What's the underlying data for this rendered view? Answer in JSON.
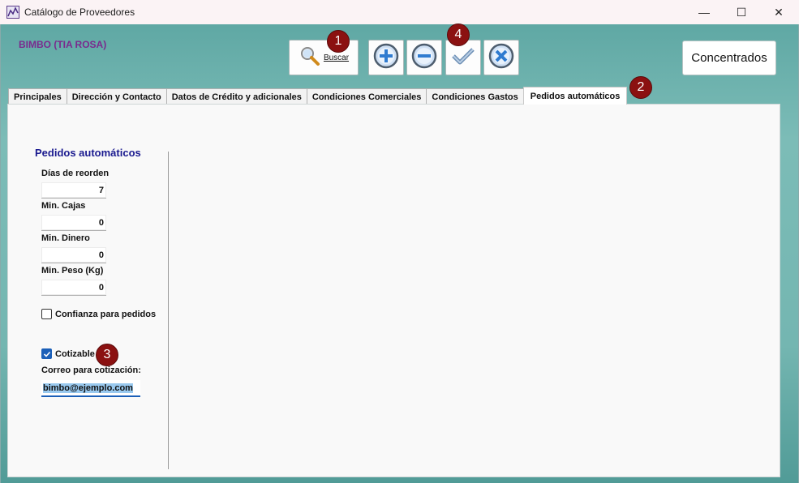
{
  "window": {
    "title": "Catálogo de Proveedores",
    "minimize_glyph": "—",
    "maximize_glyph": "☐",
    "close_glyph": "✕"
  },
  "header": {
    "supplier_name": "BIMBO (TIA ROSA)"
  },
  "toolbar": {
    "buscar_label": "Buscar",
    "concentrados_label": "Concentrados"
  },
  "markers": [
    "1",
    "2",
    "3",
    "4"
  ],
  "tabs": [
    {
      "label": "Principales"
    },
    {
      "label": "Dirección y Contacto"
    },
    {
      "label": "Datos de Crédito y adicionales"
    },
    {
      "label": "Condiciones Comerciales"
    },
    {
      "label": "Condiciones Gastos"
    },
    {
      "label": "Pedidos automáticos",
      "active": true
    }
  ],
  "panel": {
    "section_title": "Pedidos automáticos",
    "dias_reorden_label": "Días de reorden",
    "dias_reorden_value": "7",
    "min_cajas_label": "Min. Cajas",
    "min_cajas_value": "0",
    "min_dinero_label": "Min. Dinero",
    "min_dinero_value": "0",
    "min_peso_label": "Min. Peso (Kg)",
    "min_peso_value": "0",
    "confianza_label": "Confianza para pedidos",
    "confianza_checked": false,
    "cotizable_label": "Cotizable",
    "cotizable_checked": true,
    "correo_label": "Correo para cotización:",
    "correo_value": "bimbo@ejemplo.com"
  },
  "colors": {
    "accent": "#1b5fb8",
    "marker": "#8b1111",
    "supplier_name": "#7a2a8e",
    "section_title": "#1a1a8f"
  }
}
